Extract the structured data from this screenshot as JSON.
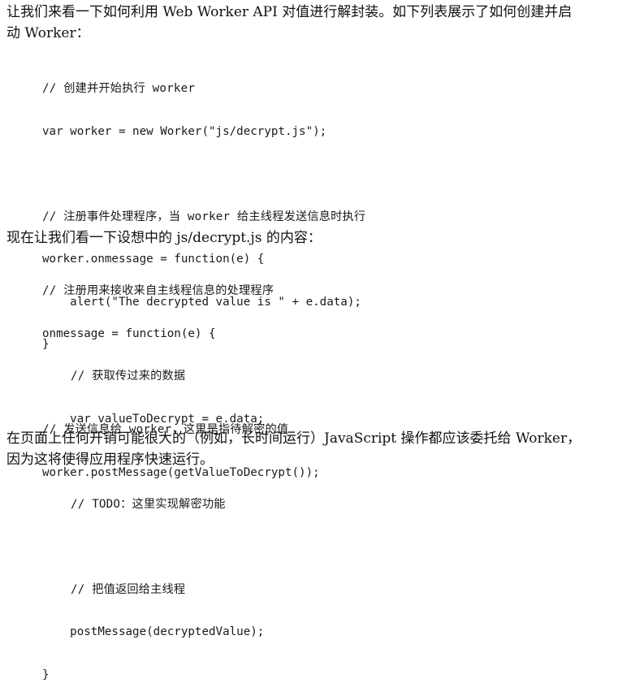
{
  "intro": {
    "line1": "让我们来看一下如何利用 Web Worker API 对值进行解封装。如下列表展示了如何创建并启",
    "line2": "动 Worker："
  },
  "code_block_1": {
    "lines": [
      "// 创建并开始执行 worker",
      "var worker = new Worker(\"js/decrypt.js\");",
      "",
      "// 注册事件处理程序，当 worker 给主线程发送信息时执行",
      "worker.onmessage = function(e) {",
      "    alert(\"The decrypted value is \" + e.data);",
      "}",
      "",
      "// 发送信息给 worker，这里是指待解密的值",
      "worker.postMessage(getValueToDecrypt());"
    ]
  },
  "middle_text": "现在让我们看一下设想中的 js/decrypt.js 的内容：",
  "code_block_2": {
    "lines": [
      "// 注册用来接收来自主线程信息的处理程序",
      "onmessage = function(e) {",
      "    // 获取传过来的数据",
      "    var valueToDecrypt = e.data;",
      "",
      "    // TODO：这里实现解密功能",
      "",
      "    // 把值返回给主线程",
      "    postMessage(decryptedValue);",
      "}"
    ]
  },
  "outro": {
    "line1": "在页面上任何开销可能很大的（例如，长时间运行）JavaScript 操作都应该委托给 Worker，",
    "line2": "因为这将使得应用程序快速运行。"
  }
}
